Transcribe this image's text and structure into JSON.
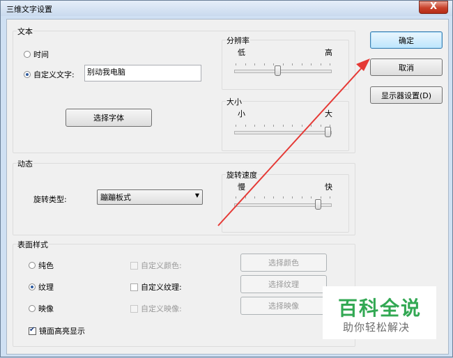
{
  "window": {
    "title": "三维文字设置",
    "close_label": "X"
  },
  "text_group": {
    "title": "文本",
    "radio_time": "时间",
    "radio_custom": "自定义文字:",
    "custom_value": "别动我电脑",
    "font_button": "选择字体"
  },
  "resolution": {
    "title": "分辨率",
    "low": "低",
    "high": "高",
    "level": 0.33
  },
  "size": {
    "title": "大小",
    "small": "小",
    "large": "大",
    "level": 1.0
  },
  "motion_group": {
    "title": "动态",
    "spin_type_label": "旋转类型:",
    "spin_type_value": "蹦蹦板式"
  },
  "spin_speed": {
    "title": "旋转速度",
    "slow": "慢",
    "fast": "快",
    "level": 0.9
  },
  "surface_group": {
    "title": "表面样式",
    "radio_solid": "纯色",
    "radio_texture": "纹理",
    "radio_reflection": "映像",
    "custom_color": "自定义颜色:",
    "custom_texture": "自定义纹理:",
    "custom_reflection": "自定义映像:",
    "btn_color": "选择颜色",
    "btn_texture": "选择纹理",
    "btn_reflection": "选择映像",
    "specular": "镜面高亮显示"
  },
  "buttons": {
    "ok": "确定",
    "cancel": "取消",
    "display_settings": "显示器设置(D)"
  },
  "watermark": {
    "brand": "百科全说",
    "slogan": "助你轻松解决"
  },
  "colors": {
    "annotation_arrow": "#e53935",
    "watermark_green": "#32a853"
  }
}
